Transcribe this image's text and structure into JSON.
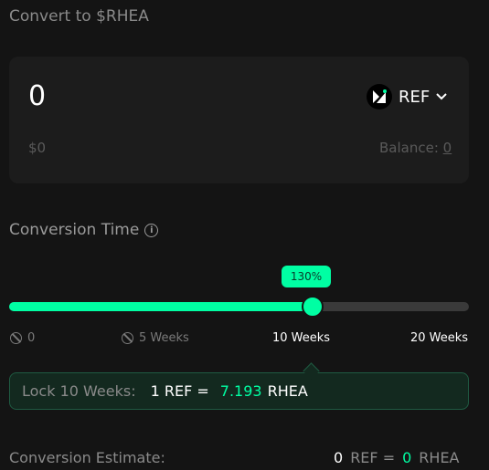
{
  "header": {
    "title": "Convert to $RHEA"
  },
  "input_card": {
    "amount": "0",
    "usd_value": "$0",
    "token": "REF",
    "balance_label": "Balance:",
    "balance_value": "0"
  },
  "conversion": {
    "title": "Conversion Time",
    "badge": "130%",
    "slider_level": 0.66,
    "ticks": [
      {
        "label": "0"
      },
      {
        "label": "5 Weeks"
      },
      {
        "label": "10 Weeks"
      },
      {
        "label": "20 Weeks"
      }
    ]
  },
  "lock": {
    "label": "Lock 10 Weeks:",
    "lhs": "1 REF =",
    "rate": "7.193",
    "unit": "RHEA"
  },
  "estimate": {
    "label": "Conversion Estimate:",
    "ref_amount": "0",
    "ref_unit": "REF =",
    "rhea_amount": "0",
    "rhea_unit": "RHEA"
  },
  "colors": {
    "accent": "#00ffa3",
    "background": "#141414",
    "card": "#1c1c1c"
  }
}
